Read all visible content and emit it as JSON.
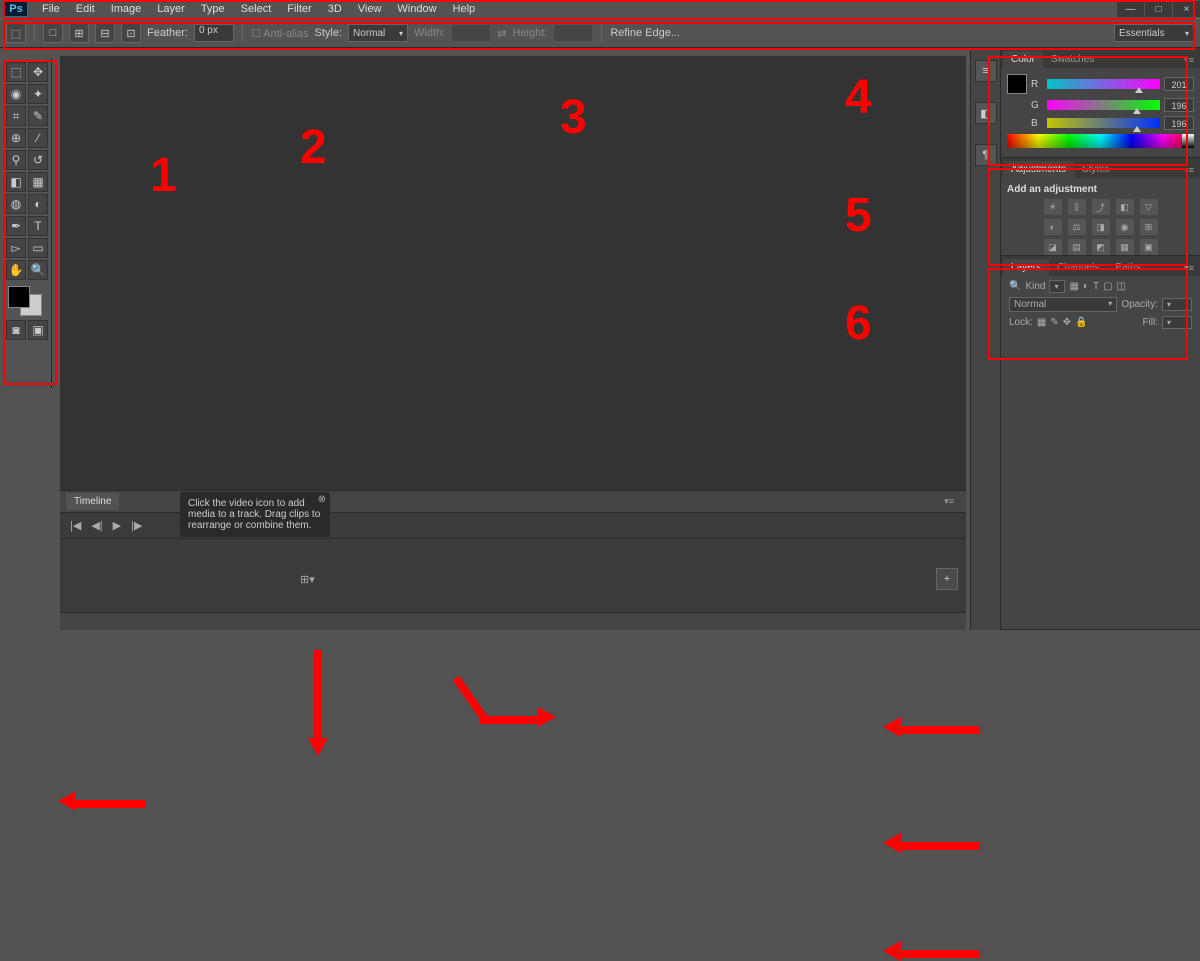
{
  "app_logo": "Ps",
  "menu": [
    "File",
    "Edit",
    "Image",
    "Layer",
    "Type",
    "Select",
    "Filter",
    "3D",
    "View",
    "Window",
    "Help"
  ],
  "window_controls": {
    "min": "—",
    "max": "□",
    "close": "×"
  },
  "options": {
    "feather_label": "Feather:",
    "feather_value": "0 px",
    "antialias": "Anti-alias",
    "style_label": "Style:",
    "style_value": "Normal",
    "width_label": "Width:",
    "height_label": "Height:",
    "refine": "Refine Edge...",
    "workspace": "Essentials"
  },
  "timeline": {
    "tab": "Timeline",
    "tooltip": "Click the video icon to add media to a track. Drag clips to rearrange or combine them.",
    "add": "+"
  },
  "color_panel": {
    "tab1": "Color",
    "tab2": "Swatches",
    "r": "R",
    "r_val": "201",
    "g": "G",
    "g_val": "196",
    "b": "B",
    "b_val": "196"
  },
  "adjustments_panel": {
    "tab1": "Adjustments",
    "tab2": "Styles",
    "header": "Add an adjustment"
  },
  "layers_panel": {
    "tab1": "Layers",
    "tab2": "Channels",
    "tab3": "Paths",
    "kind": "Kind",
    "blend": "Normal",
    "opacity_label": "Opacity:",
    "lock_label": "Lock:",
    "fill_label": "Fill:"
  },
  "annotations": {
    "n1": "1",
    "n2": "2",
    "n3": "3",
    "n4": "4",
    "n5": "5",
    "n6": "6"
  }
}
